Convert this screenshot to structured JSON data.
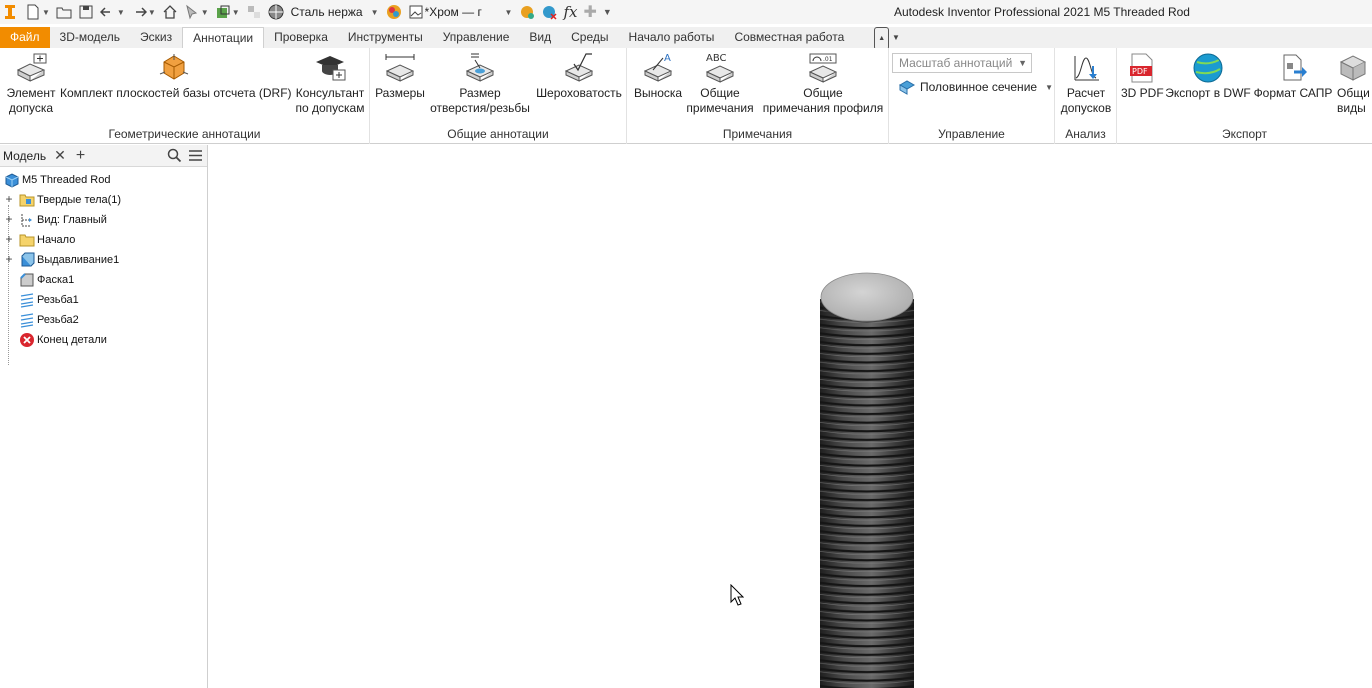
{
  "quick_access": {
    "material": "Сталь нержа",
    "appearance": "*Хром — г"
  },
  "app_title": "Autodesk Inventor Professional 2021   M5 Threaded Rod",
  "tabs": [
    {
      "label": "Файл"
    },
    {
      "label": "3D-модель"
    },
    {
      "label": "Эскиз"
    },
    {
      "label": "Аннотации"
    },
    {
      "label": "Проверка"
    },
    {
      "label": "Инструменты"
    },
    {
      "label": "Управление"
    },
    {
      "label": "Вид"
    },
    {
      "label": "Среды"
    },
    {
      "label": "Начало работы"
    },
    {
      "label": "Совместная работа"
    }
  ],
  "ribbon": {
    "geometric": {
      "label": "Геометрические аннотации",
      "tolerance_feature": [
        "Элемент",
        "допуска"
      ],
      "drf": "Комплект плоскостей базы отсчета (DRF)",
      "advisor": [
        "Консультант",
        "по допускам"
      ]
    },
    "general": {
      "label": "Общие аннотации",
      "dimensions": "Размеры",
      "hole_thread": [
        "Размер",
        "отверстия/резьбы"
      ],
      "roughness": "Шероховатость"
    },
    "notes": {
      "label": "Примечания",
      "leader": "Выноска",
      "general_notes": [
        "Общие",
        "примечания"
      ],
      "profile_notes": [
        "Общие",
        "примечания профиля"
      ]
    },
    "manage": {
      "label": "Управление",
      "scale_placeholder": "Масштаб аннотаций",
      "half_section": "Половинное сечение"
    },
    "analysis": {
      "label": "Анализ",
      "tolerance_calc": [
        "Расчет",
        "допусков"
      ]
    },
    "export": {
      "label": "Экспорт",
      "pdf": "3D PDF",
      "dwf": "Экспорт в DWF",
      "cad_format": "Формат САПР",
      "views": [
        "Общи",
        "виды"
      ]
    }
  },
  "browser": {
    "tab_label": "Модель",
    "items": [
      {
        "label": "M5 Threaded Rod"
      },
      {
        "label": "Твердые тела(1)"
      },
      {
        "label": "Вид: Главный"
      },
      {
        "label": "Начало"
      },
      {
        "label": "Выдавливание1"
      },
      {
        "label": "Фаска1"
      },
      {
        "label": "Резьба1"
      },
      {
        "label": "Резьба2"
      },
      {
        "label": "Конец детали"
      }
    ]
  },
  "colors": {
    "file_tab": "#f28c00",
    "ribbon_bg": "#ffffff",
    "rod_dark": "#3a3a3a",
    "rod_cap": "#bdbdbd",
    "error_red": "#d9262e",
    "part_blue": "#3b8fd8"
  }
}
